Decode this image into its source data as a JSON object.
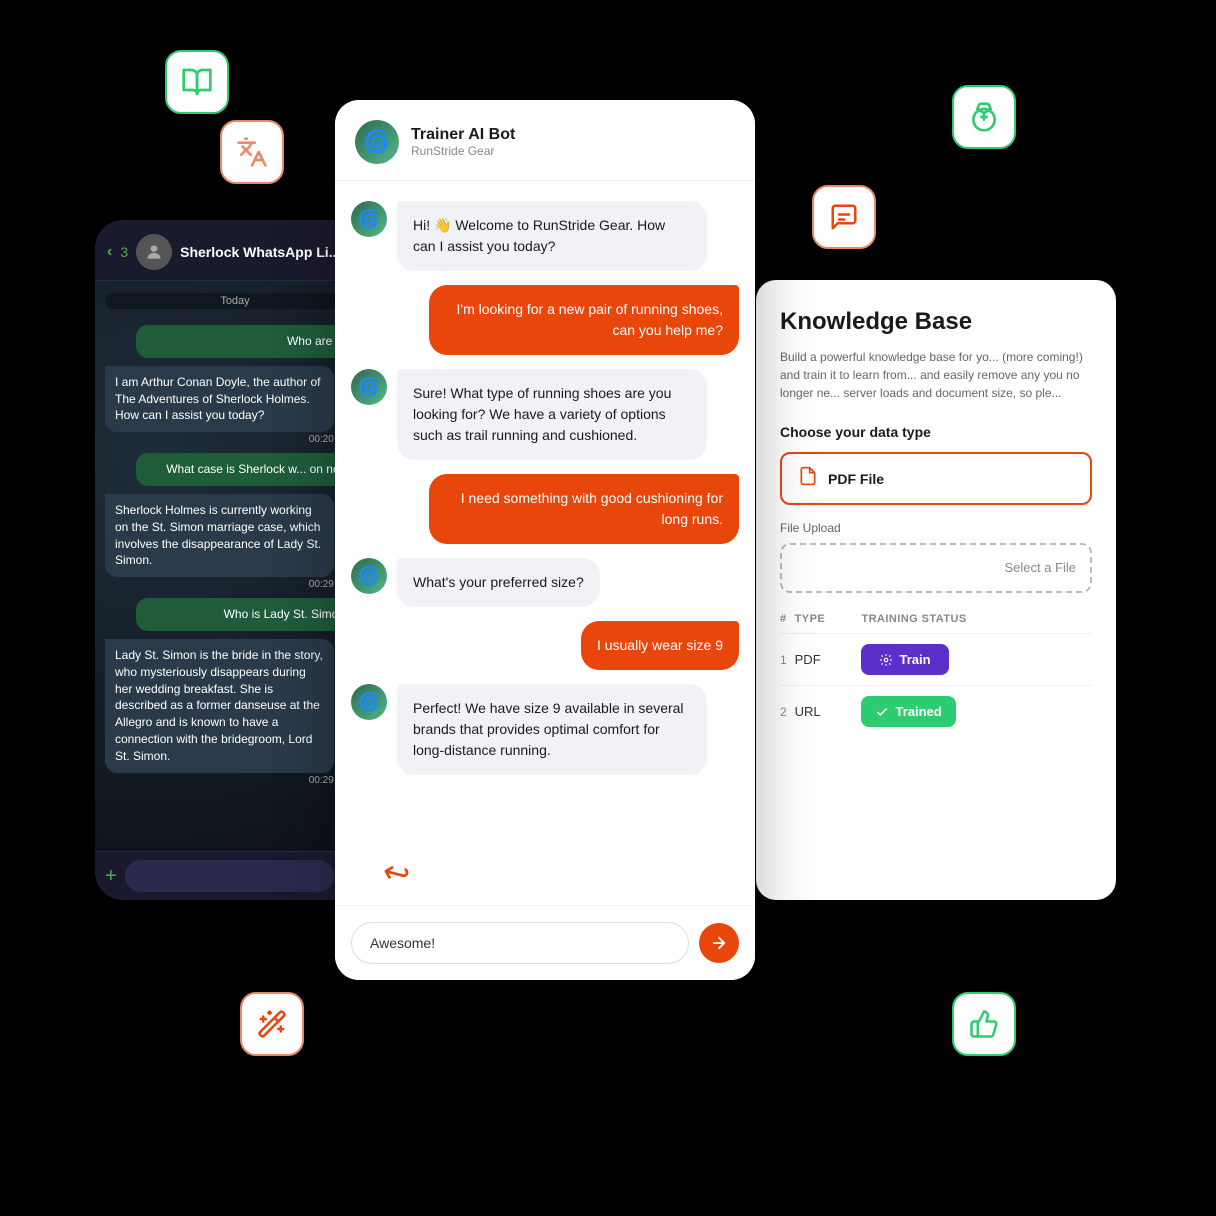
{
  "icons": {
    "book": "📖",
    "translate": "翻",
    "medal": "🥇",
    "chat_bubbles": "💬",
    "magic": "✨",
    "thumb": "👍"
  },
  "whatsapp": {
    "back_count": "3",
    "contact_name": "Sherlock WhatsApp Li...",
    "date": "Today",
    "messages": [
      {
        "type": "sent",
        "text": "Who are you",
        "time": ""
      },
      {
        "type": "received",
        "text": "I am Arthur Conan Doyle, the author of The Adventures of Sherlock Holmes. How can I assist you today?",
        "time": "00:20"
      },
      {
        "type": "sent",
        "text": "What case is Sherlock w... on now?",
        "time": ""
      },
      {
        "type": "received",
        "text": "Sherlock Holmes is currently working on the St. Simon marriage case, which involves the disappearance of Lady St. Simon.",
        "time": "00:29"
      },
      {
        "type": "sent",
        "text": "Who is Lady St. Simon...",
        "time": ""
      },
      {
        "type": "received",
        "text": "Lady St. Simon is the bride in the story, who mysteriously disappears during her wedding breakfast. She is described as a former danseuse at the Allegro and is known to have a connection with the bridegroom, Lord St. Simon.",
        "time": "00:29"
      }
    ]
  },
  "chat": {
    "bot_name": "Trainer AI Bot",
    "bot_company": "RunStride Gear",
    "messages": [
      {
        "type": "bot",
        "text": "Hi! 👋 Welcome to RunStride Gear. How can I assist you today?"
      },
      {
        "type": "user",
        "text": "I'm looking for a new pair of running shoes, can you help me?"
      },
      {
        "type": "bot",
        "text": "Sure! What type of running shoes are you looking for? We have a variety of options such as trail running and cushioned."
      },
      {
        "type": "user",
        "text": "I need something with good cushioning for long runs."
      },
      {
        "type": "bot",
        "text": "What's your preferred size?"
      },
      {
        "type": "user",
        "text": "I usually wear size 9"
      },
      {
        "type": "bot",
        "text": "Perfect! We have size 9 available in several brands that provides optimal comfort for long-distance running."
      }
    ],
    "input_placeholder": "Awesome!",
    "input_value": "Awesome!",
    "send_arrow": "→"
  },
  "knowledge_base": {
    "title": "Knowledge Base",
    "description": "Build a powerful knowledge base for yo... (more coming!) and train it to learn from... and easily remove any you no longer ne... server loads and document size, so ple...",
    "choose_label": "Choose your data type",
    "option_label": "PDF File",
    "upload_label": "File Upload",
    "upload_placeholder": "Select a File",
    "table": {
      "headers": [
        "#",
        "TYPE",
        "TRAINING STATUS"
      ],
      "rows": [
        {
          "num": "1",
          "type": "PDF",
          "status": "Train",
          "status_type": "train"
        },
        {
          "num": "2",
          "type": "URL",
          "status": "Trained",
          "status_type": "trained"
        }
      ]
    },
    "train_icon": "🔑",
    "trained_icon": "✅"
  }
}
